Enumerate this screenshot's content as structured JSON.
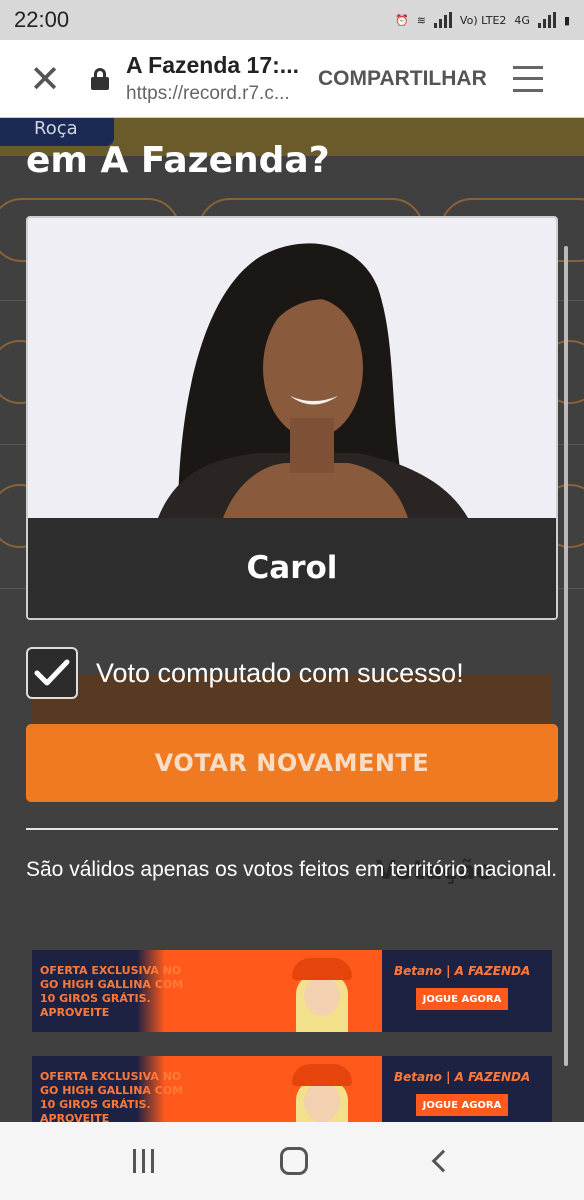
{
  "status_bar": {
    "time": "22:00",
    "network_label": "Vo) LTE2",
    "network_type": "4G"
  },
  "browser": {
    "page_title": "A Fazenda 17:...",
    "url": "https://record.r7.c...",
    "share_label": "COMPARTILHAR"
  },
  "background_page": {
    "badge": "Roça",
    "title": "em A Fazenda?"
  },
  "modal": {
    "candidate_name": "Carol",
    "vote_status": "Voto computado com sucesso!",
    "vote_again_button": "VOTAR NOVAMENTE",
    "note": "São válidos apenas os votos feitos em território nacional.",
    "ghost_text": "Votação"
  },
  "ads": [
    {
      "offer": "OFERTA EXCLUSIVA NO GO HIGH GALLINA COM 10 GIROS GRÁTIS. APROVEITE",
      "brand": "Betano | A FAZENDA",
      "cta": "JOGUE AGORA"
    },
    {
      "offer": "OFERTA EXCLUSIVA NO GO HIGH GALLINA COM 10 GIROS GRÁTIS. APROVEITE",
      "brand": "Betano | A FAZENDA",
      "cta": "JOGUE AGORA"
    }
  ],
  "colors": {
    "accent": "#ef7a21",
    "page_bg": "#404040",
    "card_bg": "#2d2d2d"
  }
}
